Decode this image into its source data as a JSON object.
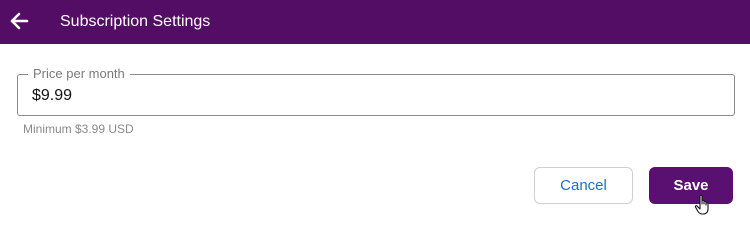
{
  "appbar": {
    "title": "Subscription Settings",
    "back_icon": "arrow-left-icon"
  },
  "price_field": {
    "label": "Price per month",
    "value": "$9.99",
    "helper": "Minimum $3.99 USD"
  },
  "actions": {
    "cancel_label": "Cancel",
    "save_label": "Save"
  },
  "colors": {
    "appbar": "#540d64",
    "primary_button": "#5a1070",
    "link_blue": "#1f6fc5"
  },
  "cursor_icon": "hand-pointer-icon"
}
